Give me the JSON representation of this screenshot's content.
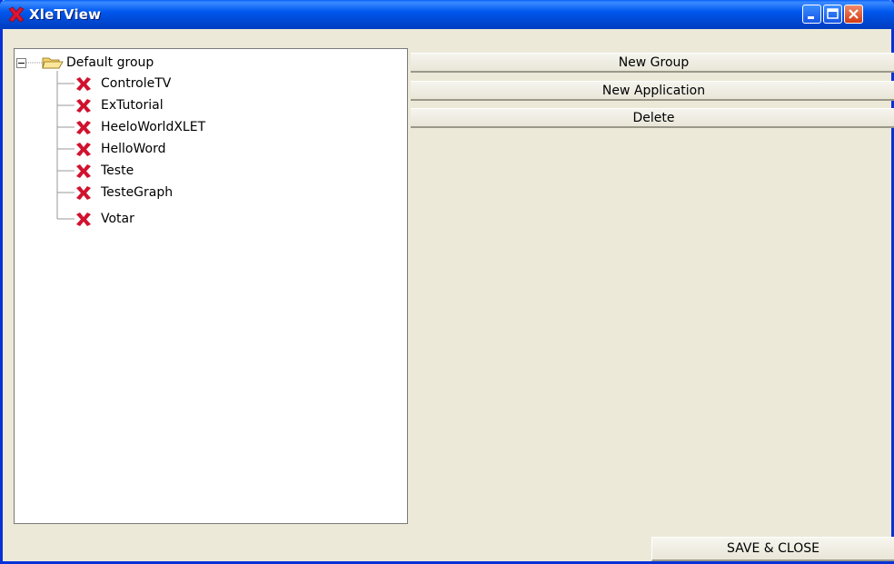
{
  "window": {
    "title": "XleTView",
    "controls": [
      "minimize-icon",
      "maximize-icon",
      "close-icon"
    ]
  },
  "tree": {
    "root": {
      "label": "Default group",
      "icon": "folder-open-icon",
      "expanded": true
    },
    "items": [
      {
        "label": "ControleTV",
        "icon": "xlet-icon"
      },
      {
        "label": "ExTutorial",
        "icon": "xlet-icon"
      },
      {
        "label": "HeeloWorldXLET",
        "icon": "xlet-icon"
      },
      {
        "label": "HelloWord",
        "icon": "xlet-icon"
      },
      {
        "label": "Teste",
        "icon": "xlet-icon"
      },
      {
        "label": "TesteGraph",
        "icon": "xlet-icon"
      },
      {
        "label": "Votar",
        "icon": "xlet-icon"
      }
    ]
  },
  "actions": {
    "new_group": "New Group",
    "new_application": "New Application",
    "delete": "Delete"
  },
  "footer": {
    "save_close": "SAVE & CLOSE"
  },
  "colors": {
    "title_bar": "#0058EE",
    "panel_bg": "#ECE9D8",
    "xlet_icon": "#D0122E"
  }
}
